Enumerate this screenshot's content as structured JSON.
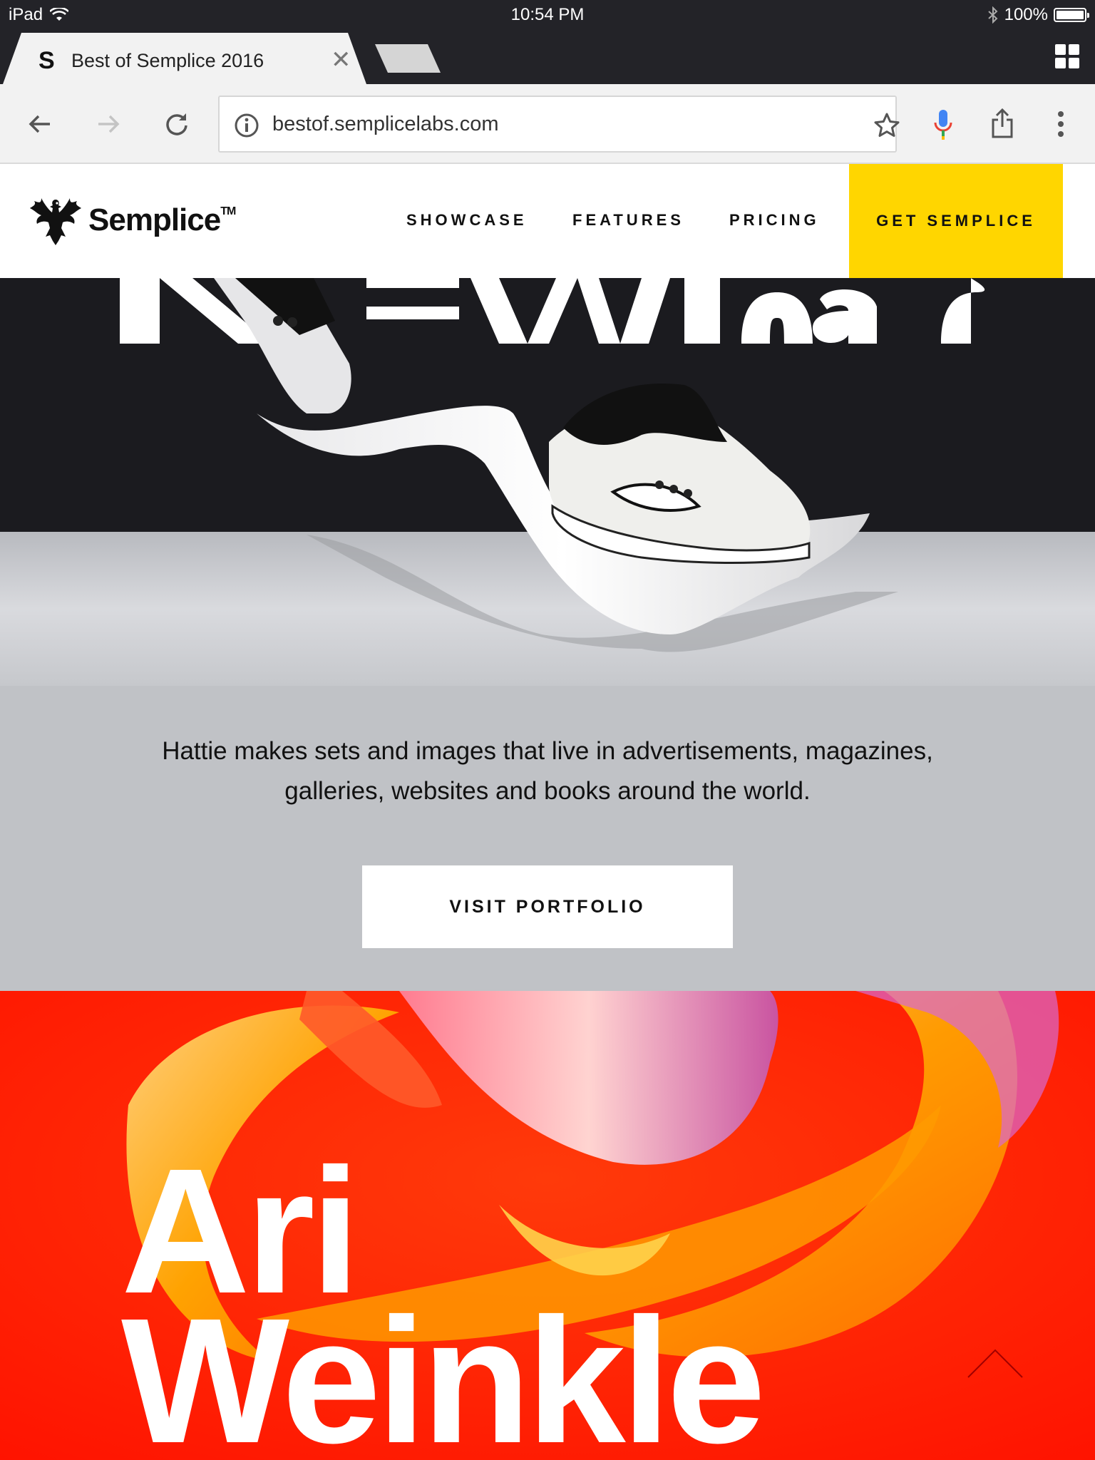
{
  "status_bar": {
    "device": "iPad",
    "time": "10:54 PM",
    "battery": "100%",
    "battery_level": 1.0
  },
  "browser": {
    "tab_favicon": "S",
    "tab_title": "Best of Semplice 2016",
    "url": "bestof.semplicelabs.com",
    "icons": [
      "back-arrow-icon",
      "forward-arrow-icon",
      "reload-icon",
      "info-icon",
      "star-icon",
      "mic-icon",
      "share-icon",
      "more-vert-icon",
      "tab-switcher-icon",
      "close-icon"
    ]
  },
  "site": {
    "logo_text": "Semplice",
    "logo_tm": "TM",
    "nav": [
      "SHOWCASE",
      "FEATURES",
      "PRICING"
    ],
    "cta": "GET SEMPLICE",
    "cta_color": "#ffd600"
  },
  "feature": {
    "description": "Hattie makes sets and images that live in advertisements, magazines, galleries, websites and books around the world.",
    "button": "VISIT PORTFOLIO"
  },
  "next_feature": {
    "name_line1": "Ari",
    "name_line2": "Weinkle",
    "bg_color": "#ff1a00"
  }
}
